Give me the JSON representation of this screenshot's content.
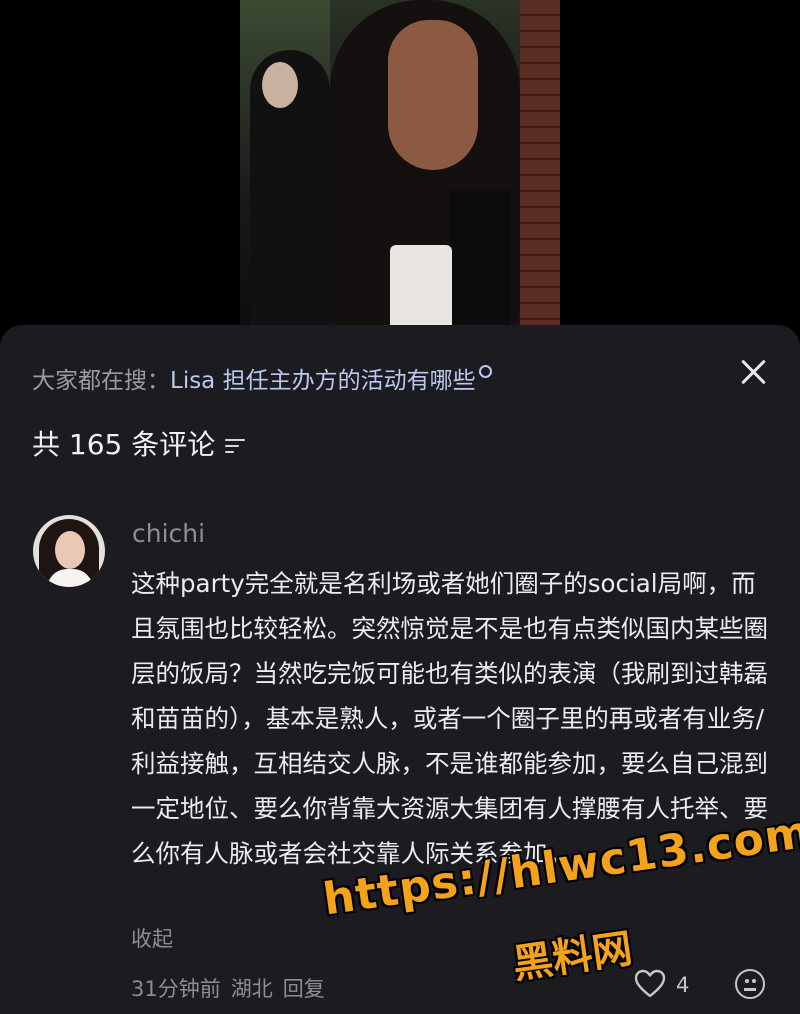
{
  "search_bar": {
    "prefix": "大家都在搜：",
    "keyword": "Lisa 担任主办方的活动有哪些"
  },
  "comments": {
    "count_label": "共 165 条评论"
  },
  "comment": {
    "username": "chichi",
    "text": "这种party完全就是名利场或者她们圈子的social局啊，而且氛围也比较轻松。突然惊觉是不是也有点类似国内某些圈层的饭局？当然吃完饭可能也有类似的表演（我刷到过韩磊和苗苗的），基本是熟人，或者一个圈子里的再或者有业务/利益接触，互相结交人脉，不是谁都能参加，要么自己混到一定地位、要么你背靠大资源大集团有人撑腰有人托举、要么你有人脉或者会社交靠人际关系参加。",
    "collapse_label": "收起",
    "time": "31分钟前",
    "location": "湖北",
    "reply_label": "回复",
    "like_count": "4"
  },
  "watermark": {
    "url": "https://hlwc13.com",
    "name": "黑料网"
  },
  "icons": {
    "close": "close-icon",
    "search": "search-icon",
    "sort": "sort-icon",
    "like": "heart-icon",
    "emoji": "emoji-icon"
  },
  "colors": {
    "sheet_bg": "#1b1b20",
    "keyword": "#b9c9ef",
    "muted": "#8d8d93",
    "watermark": "#f3a21a"
  }
}
